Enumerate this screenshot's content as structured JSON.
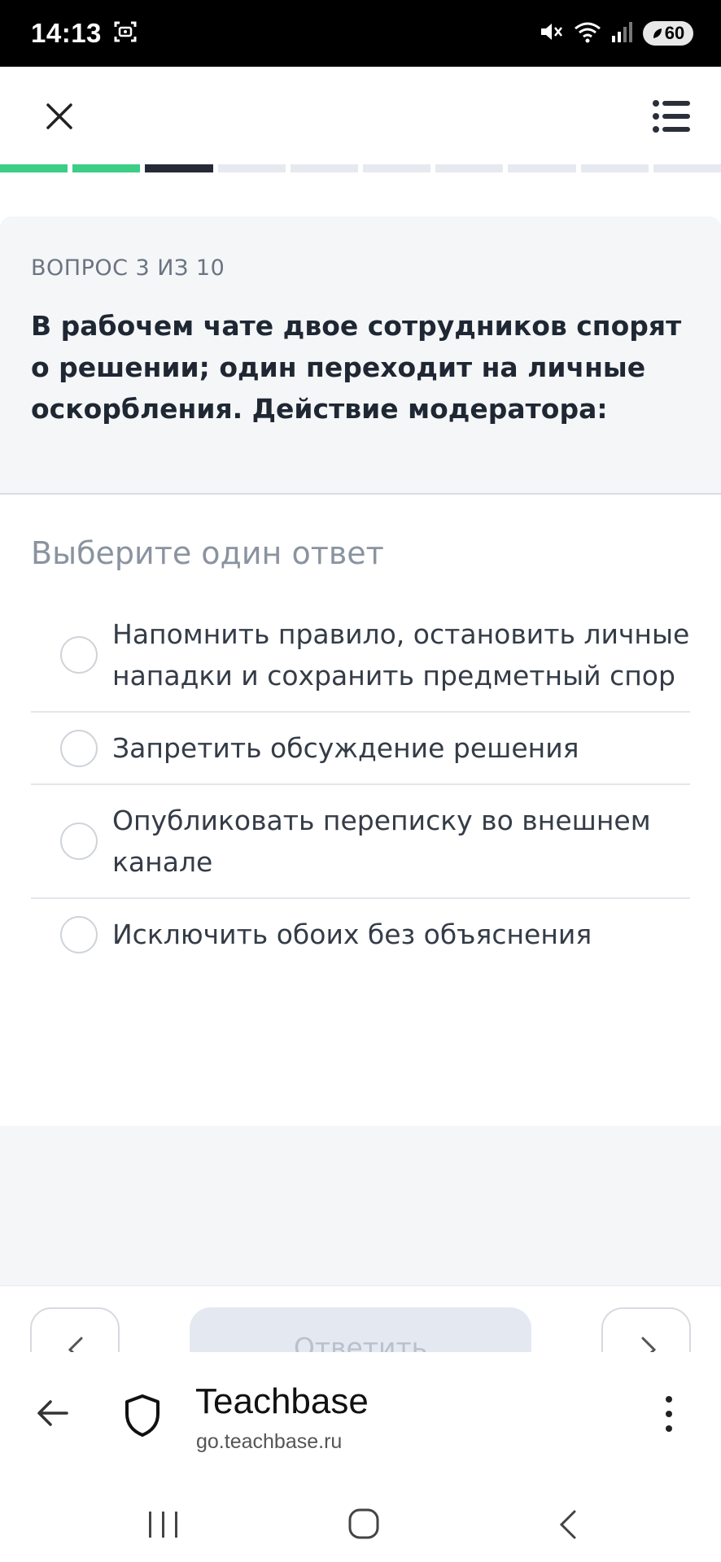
{
  "status_bar": {
    "time": "14:13",
    "battery": "60"
  },
  "progress": {
    "total": 10,
    "completed": 2,
    "current": 3,
    "colors": {
      "done": "#3ccd86",
      "current": "#252a36",
      "pending": "#e6e9ef"
    }
  },
  "question": {
    "counter": "ВОПРОС 3 ИЗ 10",
    "text": "В рабочем чате двое сотрудников спорят о решении; один переходит на личные оскорбления. Действие модератора:"
  },
  "answers": {
    "hint": "Выберите один ответ",
    "options": [
      "Напомнить правило, остановить личные нападки и сохранить предметный спор",
      "Запретить обсуждение решения",
      "Опубликовать переписку во внешнем канале",
      "Исключить обоих без объяснения"
    ]
  },
  "controls": {
    "answer_label": "Ответить"
  },
  "browser": {
    "title": "Teachbase",
    "url": "go.teachbase.ru"
  }
}
